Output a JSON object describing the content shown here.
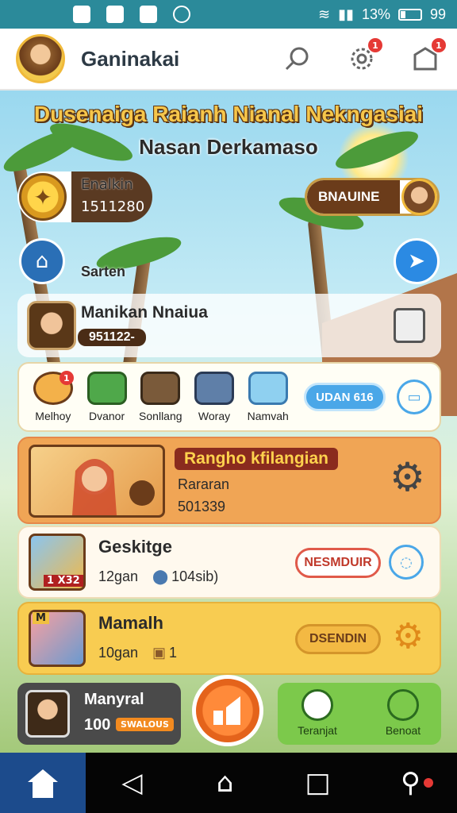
{
  "status_bar": {
    "battery": "13%",
    "time": "99",
    "icons": [
      "image-icon",
      "check-icon",
      "shield-icon",
      "circle-icon"
    ]
  },
  "app_bar": {
    "title": "Ganinakai",
    "icons": [
      "search-icon",
      "settings-icon",
      "notification-icon"
    ],
    "settings_badge": "1",
    "notification_badge": "1"
  },
  "headline": {
    "line1": "Dusenaiga Raianh Nianal Nekngasiai",
    "line2": "Nasan Derkamaso"
  },
  "currency": {
    "name": "Enalkin",
    "value": "1511280"
  },
  "right_pill": {
    "label": "BNAUINE"
  },
  "home_label": "Sarten",
  "profile": {
    "name": "Manikan Nnaiua",
    "value": "951122-"
  },
  "inventory": {
    "items": [
      {
        "label": "Melhoy",
        "icon": "gem-icon",
        "badge": "1"
      },
      {
        "label": "Dvanor",
        "icon": "scroll-icon"
      },
      {
        "label": "Sonllang",
        "icon": "crate-icon"
      },
      {
        "label": "Woray",
        "icon": "bag-icon"
      },
      {
        "label": "Namvah",
        "icon": "map-icon"
      }
    ],
    "button": "UDAN 616"
  },
  "quest_card": {
    "title": "Rangho kfilangian",
    "line1": "Rararan",
    "line2": "501339"
  },
  "card_2": {
    "title": "Geskitge",
    "time": "12gan",
    "reward": "104sib)",
    "tag": "1 X32",
    "button": "NESMDUIR"
  },
  "card_3": {
    "title": "Mamalh",
    "time": "10gan",
    "reward": "1",
    "tag": "M",
    "button": "DSENDIN"
  },
  "player_card": {
    "name": "Manyral",
    "value": "100",
    "badge": "SWALOUS"
  },
  "bottom_actions": [
    {
      "label": "Teranjat",
      "icon": "check-icon"
    },
    {
      "label": "Benoat",
      "icon": "gear-icon"
    }
  ],
  "colors": {
    "status_bar": "#2b8a9a",
    "accent_orange": "#f0a555",
    "accent_yellow": "#f8cc51",
    "accent_green": "#7cc94b",
    "accent_blue": "#4aa7e8",
    "nav_home": "#1c4b8c"
  }
}
